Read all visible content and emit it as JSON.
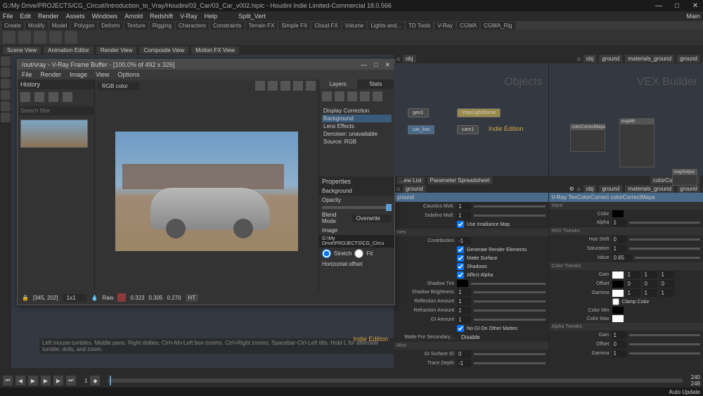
{
  "title": "G:/My Drive/PROJECTS/CG_Circuit/Introduction_to_Vray/Houdini/03_Car/03_Car_v002.hiplc - Houdini Indie Limited-Commercial 18.0.566",
  "menu": [
    "File",
    "Edit",
    "Render",
    "Assets",
    "Windows",
    "Arnold",
    "Redshift",
    "V-Ray",
    "Help"
  ],
  "desktop": "Split_Vert",
  "main_dropdown": "Main",
  "shelf_tabs": [
    "Create",
    "Modify",
    "Model",
    "Polygon",
    "Deform",
    "Texture",
    "Rigging",
    "Characters",
    "Constraints",
    "Terrain FX",
    "Simple FX",
    "Cloud FX",
    "Volume",
    "Lights and...",
    "TD Tools",
    "V-Ray",
    "CGMA",
    "CGMA_Rig"
  ],
  "pane_tabs": [
    "Scene View",
    "Animation Editor",
    "Render View",
    "Composite View",
    "Motion FX View"
  ],
  "vfb": {
    "title": "/out/vray - V-Ray Frame Buffer - [100.0% of 492 x 326]",
    "menu": [
      "File",
      "Render",
      "Image",
      "View",
      "Options"
    ],
    "history_label": "History",
    "search_placeholder": "Search filter",
    "channel": "RGB color",
    "layers_tab": "Layers",
    "stats_tab": "Stats",
    "tree": {
      "display": "Display Correction",
      "bg": "Background",
      "lens": "Lens Effects",
      "denoise": "Denoiser: unavailable",
      "source": "Source: RGB"
    },
    "props": {
      "title": "Properties",
      "bg": "Background",
      "opacity": "Opacity",
      "blend": "Blend Mode",
      "blend_val": "Overwrite",
      "image": "Image",
      "path": "G:\\My Drive\\PROJECTS\\CG_Circu",
      "stretch": "Stretch",
      "fit": "Fit",
      "hoff": "Horizontal offset"
    },
    "footer": {
      "coords": "[345, 202]",
      "zoom": "1x1",
      "raw": "Raw",
      "r": "0.323",
      "g": "0.305",
      "b": "0.270",
      "ht": "HT"
    }
  },
  "path_bar_left": [
    "obj"
  ],
  "path_bar_right": [
    "obj",
    "ground",
    "materials_ground",
    "ground"
  ],
  "network": {
    "objects_label": "Objects",
    "vex_label": "VEX Builder",
    "indie": "Indie Edition",
    "nodes": {
      "geo1": "geo1",
      "light": "VrayLightDome",
      "car": "car_low",
      "cam": "cam1"
    },
    "vex_nodes": {
      "cc": "colorCorrectMaya",
      "mtl": "vrayMtl",
      "out": "vrayOutput"
    }
  },
  "status": "Left mouse tumbles. Middle pans. Right dollies. Ctrl+Alt+Left box-zooms. Ctrl+Right zooms. Spacebar-Ctrl-Left tilts. Hold L for alternate tumble, dolly, and zoom.",
  "params_left": {
    "tabs": [
      "...ew List",
      "Parameter Spreadsheet"
    ],
    "header": "ground",
    "caustics": "Caustics Mult.",
    "subdivs": "Subdivs Mult.",
    "irr": "Use Irradiance Map",
    "cont": "Contribution",
    "gen": "Generate Render Elements",
    "matte": "Matte Surface",
    "shadows": "Shadows",
    "alpha": "Affect Alpha",
    "tint": "Shadow Tint",
    "bright": "Shadow Brightness",
    "reflect": "Reflection Amount",
    "refract": "Refraction Amount",
    "gi": "GI Amount",
    "nogi": "No GI On Other Mattes",
    "msec": "Matte For Secondary...",
    "msec_val": "Disable",
    "misc": "Misc",
    "surfid": "GI Surface ID",
    "trace": "Trace Depth",
    "v1": "1",
    "vn1": "-1",
    "v0": "0"
  },
  "params_right": {
    "tab": "colorCorrectMaya",
    "header": "V-Ray TexColorCorrect colorCorrectMaya",
    "input": "Input",
    "color": "Color",
    "alpha": "Alpha",
    "hsv": "HSV Tweaks",
    "hue": "Hue Shift",
    "sat": "Saturation",
    "value": "Value",
    "value_val": "0.65",
    "ctweaks": "Color Tweaks",
    "gain": "Gain",
    "offset": "Offset",
    "gamma": "Gamma",
    "clamp": "Clamp Color",
    "cmin": "Color Min",
    "cmax": "Color Max",
    "atweaks": "Alpha Tweaks",
    "v0": "0",
    "v1": "1"
  },
  "timeline": {
    "frame_cur": "1",
    "frame_end": "240",
    "frame_total": "248"
  },
  "auto_update": "Auto Update"
}
